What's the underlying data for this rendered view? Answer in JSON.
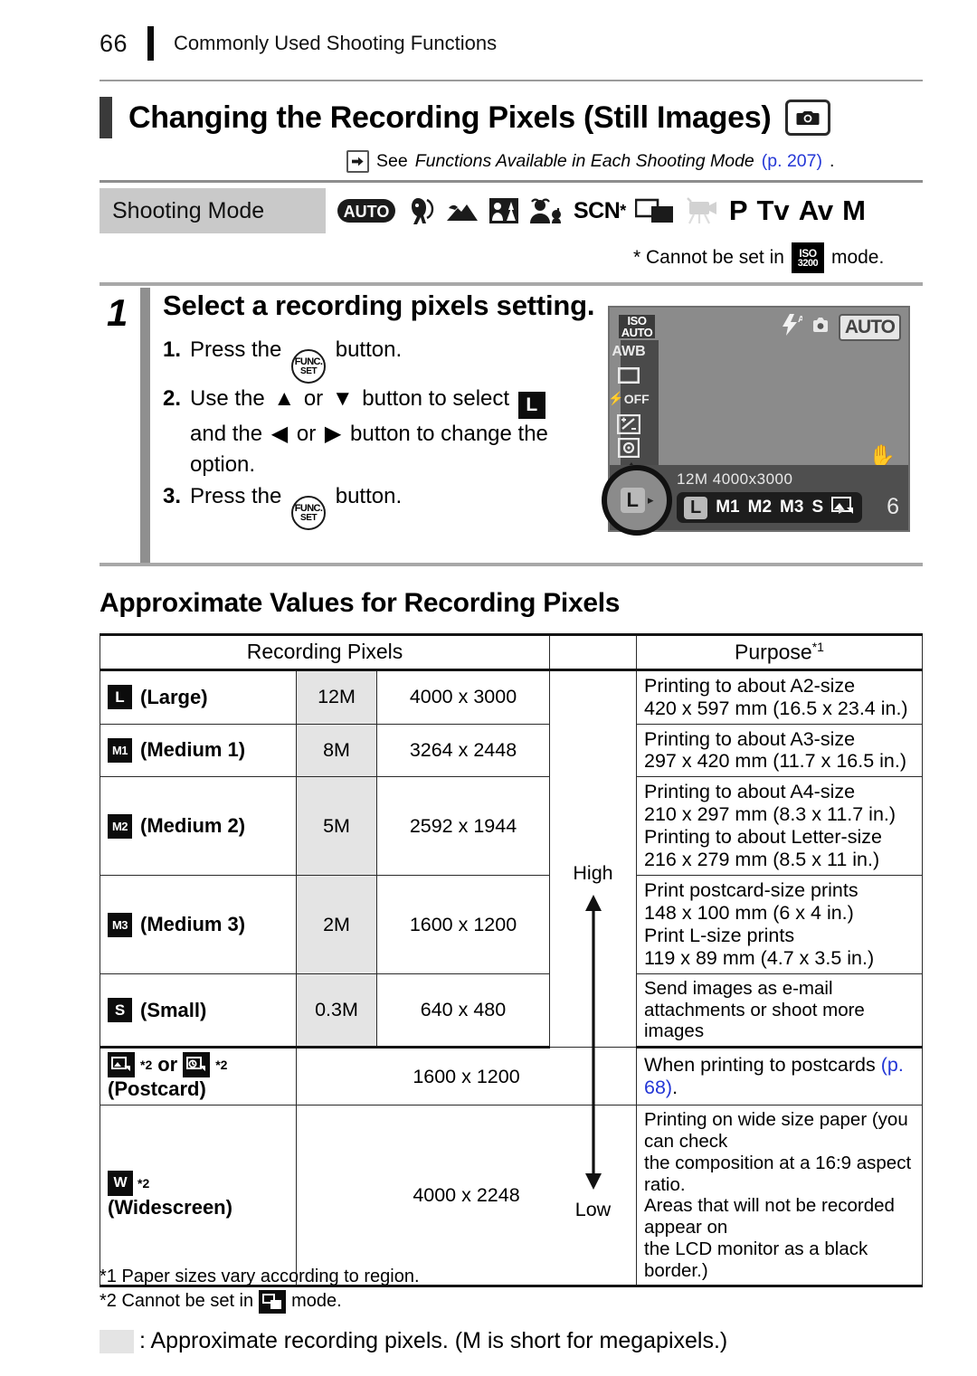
{
  "header": {
    "page_number": "66",
    "chapter": "Commonly Used Shooting Functions"
  },
  "title": {
    "text": "Changing the Recording Pixels (Still Images)",
    "badge_icon": "camera-icon",
    "see_prefix": "See ",
    "see_italic": "Functions Available in Each Shooting Mode",
    "see_link": "(p. 207)",
    "see_suffix": "."
  },
  "shooting_mode": {
    "label": "Shooting Mode",
    "icons": [
      {
        "name": "auto-mode-icon",
        "text": "AUTO"
      },
      {
        "name": "portrait-mode-icon",
        "text": ""
      },
      {
        "name": "landscape-mode-icon",
        "text": ""
      },
      {
        "name": "night-snapshot-mode-icon",
        "text": ""
      },
      {
        "name": "kids-and-pets-mode-icon",
        "text": ""
      },
      {
        "name": "scn-mode-icon",
        "text": "SCN"
      },
      {
        "name": "stitch-assist-mode-icon",
        "text": ""
      },
      {
        "name": "movie-mode-icon",
        "text": ""
      },
      {
        "name": "program-mode-icon",
        "text": "P"
      },
      {
        "name": "tv-mode-icon",
        "text": "Tv"
      },
      {
        "name": "av-mode-icon",
        "text": "Av"
      },
      {
        "name": "manual-mode-icon",
        "text": "M"
      }
    ],
    "star": "*",
    "note_prefix": "* Cannot be set in",
    "note_icon_line1": "ISO",
    "note_icon_line2": "3200",
    "note_suffix": "mode."
  },
  "step": {
    "number": "1",
    "heading": "Select a recording pixels setting.",
    "items": [
      {
        "n": "1.",
        "a": "Press the",
        "b": "button.",
        "btn": "FUNC-SET"
      },
      {
        "n": "2.",
        "a": "Use the",
        "b": "or",
        "c": "button to select",
        "d": "and the",
        "e": "or",
        "f": "button to change the option."
      },
      {
        "n": "3.",
        "a": "Press the",
        "b": "button.",
        "btn": "FUNC-SET"
      }
    ],
    "func_line1": "FUNC.",
    "func_line2": "SET",
    "select_badge": "L"
  },
  "lcd": {
    "iso_line1": "ISO",
    "iso_line2": "AUTO",
    "awb": "AWB",
    "flash_off": "OFF",
    "mode_badge": "AUTO",
    "resolution": "12M  4000x3000",
    "options": [
      "L",
      "M1",
      "M2",
      "M3",
      "S"
    ],
    "selected_option": "L",
    "postcard_option_icon": "postcard-icon",
    "next_arrow": "▸",
    "shots_remaining": "6",
    "callout_label": "L"
  },
  "section_heading": "Approximate Values for Recording Pixels",
  "table": {
    "head": {
      "recording_pixels": "Recording Pixels",
      "purpose": "Purpose",
      "purpose_sup": "*1"
    },
    "quality_high": "High",
    "quality_low": "Low",
    "rows": [
      {
        "icon": "L",
        "icon_name": "large-size-icon",
        "name": "(Large)",
        "mp": "12M",
        "dim": "4000 x 3000",
        "purpose": [
          "Printing to about A2-size",
          "420 x 597 mm (16.5 x 23.4 in.)"
        ]
      },
      {
        "icon": "M1",
        "icon_name": "medium1-size-icon",
        "name": "(Medium 1)",
        "mp": "8M",
        "dim": "3264 x 2448",
        "purpose": [
          "Printing to about A3-size",
          "297 x 420 mm (11.7 x 16.5 in.)"
        ]
      },
      {
        "icon": "M2",
        "icon_name": "medium2-size-icon",
        "name": "(Medium 2)",
        "mp": "5M",
        "dim": "2592 x 1944",
        "purpose": [
          "Printing to about A4-size",
          "210 x 297 mm (8.3 x 11.7 in.)",
          "Printing to about Letter-size",
          "216 x 279 mm (8.5 x 11 in.)"
        ]
      },
      {
        "icon": "M3",
        "icon_name": "medium3-size-icon",
        "name": "(Medium 3)",
        "mp": "2M",
        "dim": "1600 x 1200",
        "purpose": [
          "Print postcard-size prints",
          "148 x 100 mm (6 x 4 in.)",
          "Print L-size prints",
          "119 x 89 mm (4.7 x 3.5 in.)"
        ]
      },
      {
        "icon": "S",
        "icon_name": "small-size-icon",
        "name": "(Small)",
        "mp": "0.3M",
        "dim": "640 x 480",
        "purpose": [
          "Send images as e-mail",
          "attachments or shoot more images"
        ]
      }
    ],
    "postcard_row": {
      "icon_name": "postcard-icon",
      "icon2_name": "postcard-date-icon",
      "sup": "*2",
      "or": "or",
      "name": "(Postcard)",
      "dim": "1600 x 1200",
      "purpose_text": "When printing to postcards ",
      "purpose_link": "(p. 68)",
      "purpose_suffix": "."
    },
    "widescreen_row": {
      "icon": "W",
      "icon_name": "widescreen-icon",
      "sup": "*2",
      "name": "(Widescreen)",
      "dim": "4000 x 2248",
      "purpose": [
        "Printing on wide size paper (you can check",
        "the composition at a 16:9 aspect ratio.",
        "Areas that will not be recorded appear on",
        "the LCD monitor as a black border.)"
      ]
    }
  },
  "footnotes": {
    "f1": "*1 Paper sizes vary according to region.",
    "f2_prefix": "*2 Cannot be set in",
    "f2_icon_name": "stitch-assist-icon",
    "f2_suffix": "mode.",
    "legend": ": Approximate recording pixels. (M is short for megapixels.)"
  }
}
